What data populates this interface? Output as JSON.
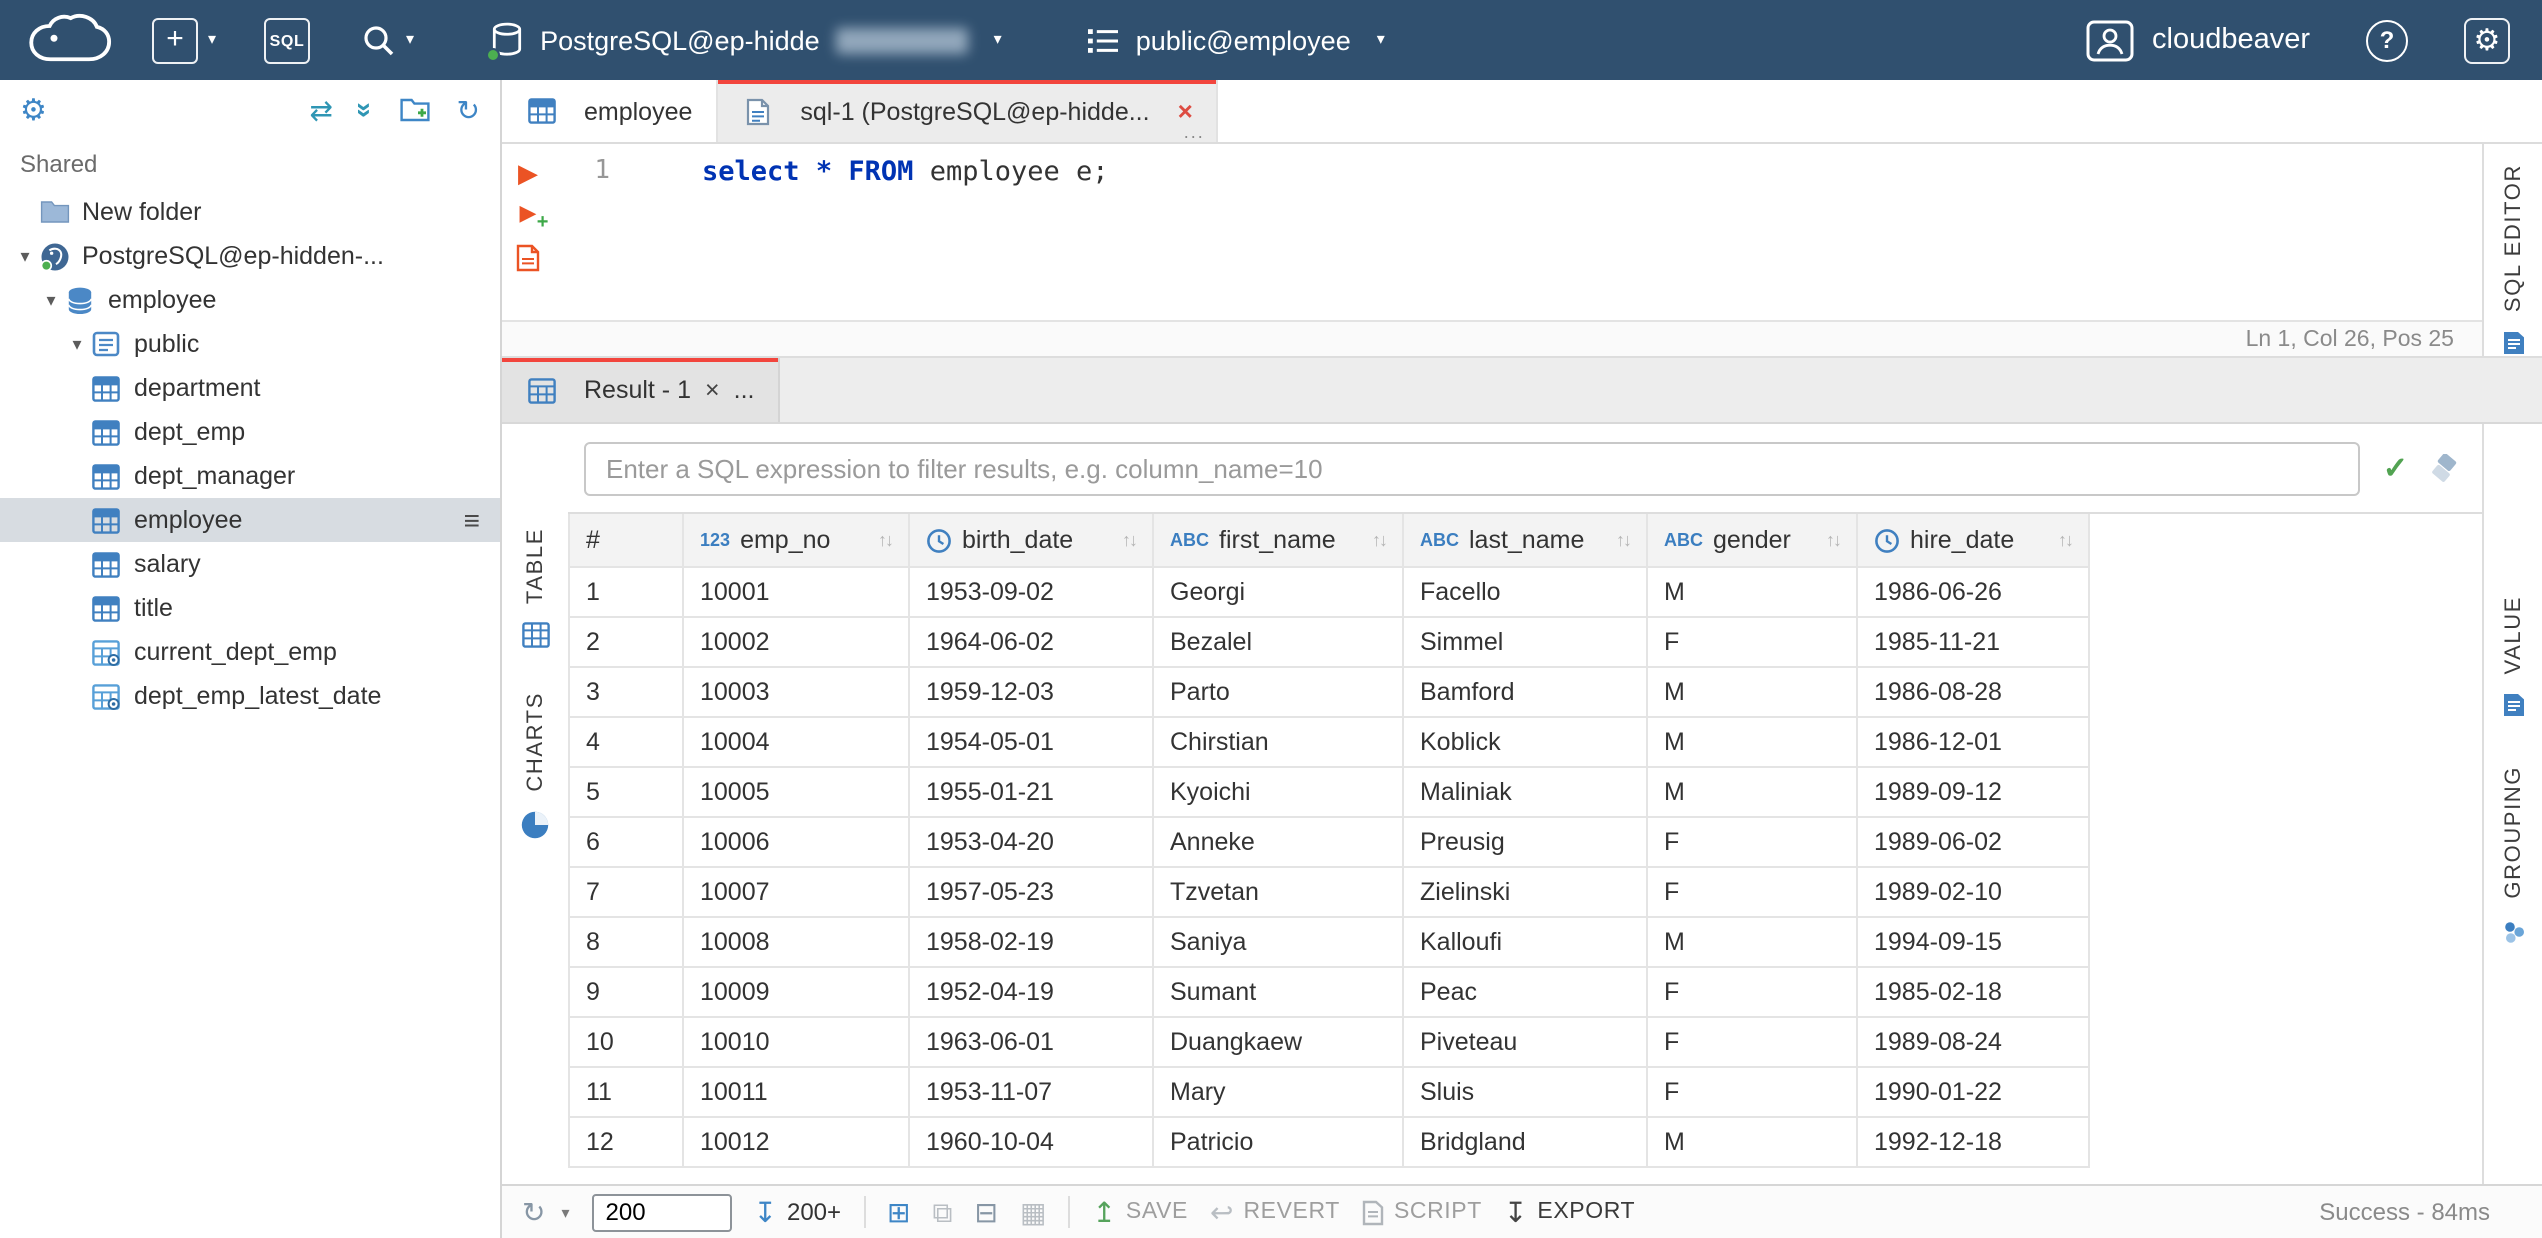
{
  "icons": {
    "plus": "+",
    "help": "?",
    "gear": "⚙",
    "hamburger": "≡",
    "swap": "⇄",
    "collapse": "»",
    "refresh": "↻",
    "caret": "▾",
    "run": "▶",
    "close": "×",
    "dots": "...",
    "check": "✓",
    "sort": "↑↓",
    "save_arrow": "↥",
    "export_arrow": "↧",
    "revert_arrow": "↩",
    "add_row": "⊞",
    "delete_row": "⊟",
    "duplicate_row": "⧉",
    "grid_misc": "▦"
  },
  "topbar": {
    "sql_button_label": "SQL",
    "connection_label": "PostgreSQL@ep-hidde",
    "schema_label": "public@employee",
    "brand": "cloudbeaver"
  },
  "sidebar": {
    "section_label": "Shared",
    "tree": [
      {
        "label": "New folder",
        "depth": 0,
        "icon": "folder",
        "slot": true
      },
      {
        "label": "PostgreSQL@ep-hidden-...",
        "depth": 0,
        "icon": "postgres",
        "expanded": true
      },
      {
        "label": "employee",
        "depth": 1,
        "icon": "database",
        "expanded": true
      },
      {
        "label": "public",
        "depth": 2,
        "icon": "schema",
        "expanded": true
      },
      {
        "label": "department",
        "depth": 3,
        "icon": "table"
      },
      {
        "label": "dept_emp",
        "depth": 3,
        "icon": "table"
      },
      {
        "label": "dept_manager",
        "depth": 3,
        "icon": "table"
      },
      {
        "label": "employee",
        "depth": 3,
        "icon": "table",
        "selected": true
      },
      {
        "label": "salary",
        "depth": 3,
        "icon": "table"
      },
      {
        "label": "title",
        "depth": 3,
        "icon": "table"
      },
      {
        "label": "current_dept_emp",
        "depth": 3,
        "icon": "view"
      },
      {
        "label": "dept_emp_latest_date",
        "depth": 3,
        "icon": "view"
      }
    ]
  },
  "editor": {
    "tabs": [
      {
        "label": "employee"
      },
      {
        "label": "sql-1 (PostgreSQL@ep-hidde..."
      }
    ],
    "line_number": "1",
    "code": {
      "kw1": "select",
      "star": "*",
      "kw2": "FROM",
      "rest": "employee e;"
    },
    "status": "Ln 1, Col 26, Pos 25",
    "side_tab": "SQL EDITOR"
  },
  "result": {
    "tab_label": "Result - 1",
    "filter_placeholder": "Enter a SQL expression to filter results, e.g. column_name=10",
    "left_tabs": [
      {
        "label": "TABLE"
      },
      {
        "label": "CHARTS"
      }
    ],
    "right_tabs": [
      {
        "label": "VALUE"
      },
      {
        "label": "GROUPING"
      }
    ],
    "grid": {
      "columns": [
        {
          "name": "#",
          "badge": null,
          "sortable": false
        },
        {
          "name": "emp_no",
          "badge": "123",
          "sortable": true
        },
        {
          "name": "birth_date",
          "badge": "clock",
          "sortable": true
        },
        {
          "name": "first_name",
          "badge": "ABC",
          "sortable": true
        },
        {
          "name": "last_name",
          "badge": "ABC",
          "sortable": true
        },
        {
          "name": "gender",
          "badge": "ABC",
          "sortable": true
        },
        {
          "name": "hire_date",
          "badge": "clock",
          "sortable": true
        }
      ],
      "rows": [
        [
          "1",
          "10001",
          "1953-09-02",
          "Georgi",
          "Facello",
          "M",
          "1986-06-26"
        ],
        [
          "2",
          "10002",
          "1964-06-02",
          "Bezalel",
          "Simmel",
          "F",
          "1985-11-21"
        ],
        [
          "3",
          "10003",
          "1959-12-03",
          "Parto",
          "Bamford",
          "M",
          "1986-08-28"
        ],
        [
          "4",
          "10004",
          "1954-05-01",
          "Chirstian",
          "Koblick",
          "M",
          "1986-12-01"
        ],
        [
          "5",
          "10005",
          "1955-01-21",
          "Kyoichi",
          "Maliniak",
          "M",
          "1989-09-12"
        ],
        [
          "6",
          "10006",
          "1953-04-20",
          "Anneke",
          "Preusig",
          "F",
          "1989-06-02"
        ],
        [
          "7",
          "10007",
          "1957-05-23",
          "Tzvetan",
          "Zielinski",
          "F",
          "1989-02-10"
        ],
        [
          "8",
          "10008",
          "1958-02-19",
          "Saniya",
          "Kalloufi",
          "M",
          "1994-09-15"
        ],
        [
          "9",
          "10009",
          "1952-04-19",
          "Sumant",
          "Peac",
          "F",
          "1985-02-18"
        ],
        [
          "10",
          "10010",
          "1963-06-01",
          "Duangkaew",
          "Piveteau",
          "F",
          "1989-08-24"
        ],
        [
          "11",
          "10011",
          "1953-11-07",
          "Mary",
          "Sluis",
          "F",
          "1990-01-22"
        ],
        [
          "12",
          "10012",
          "1960-10-04",
          "Patricio",
          "Bridgland",
          "M",
          "1992-12-18"
        ]
      ]
    }
  },
  "toolbar": {
    "row_limit_value": "200",
    "fetch_more_label": "200+",
    "save_label": "SAVE",
    "revert_label": "REVERT",
    "script_label": "SCRIPT",
    "export_label": "EXPORT",
    "status": "Success - 84ms"
  }
}
